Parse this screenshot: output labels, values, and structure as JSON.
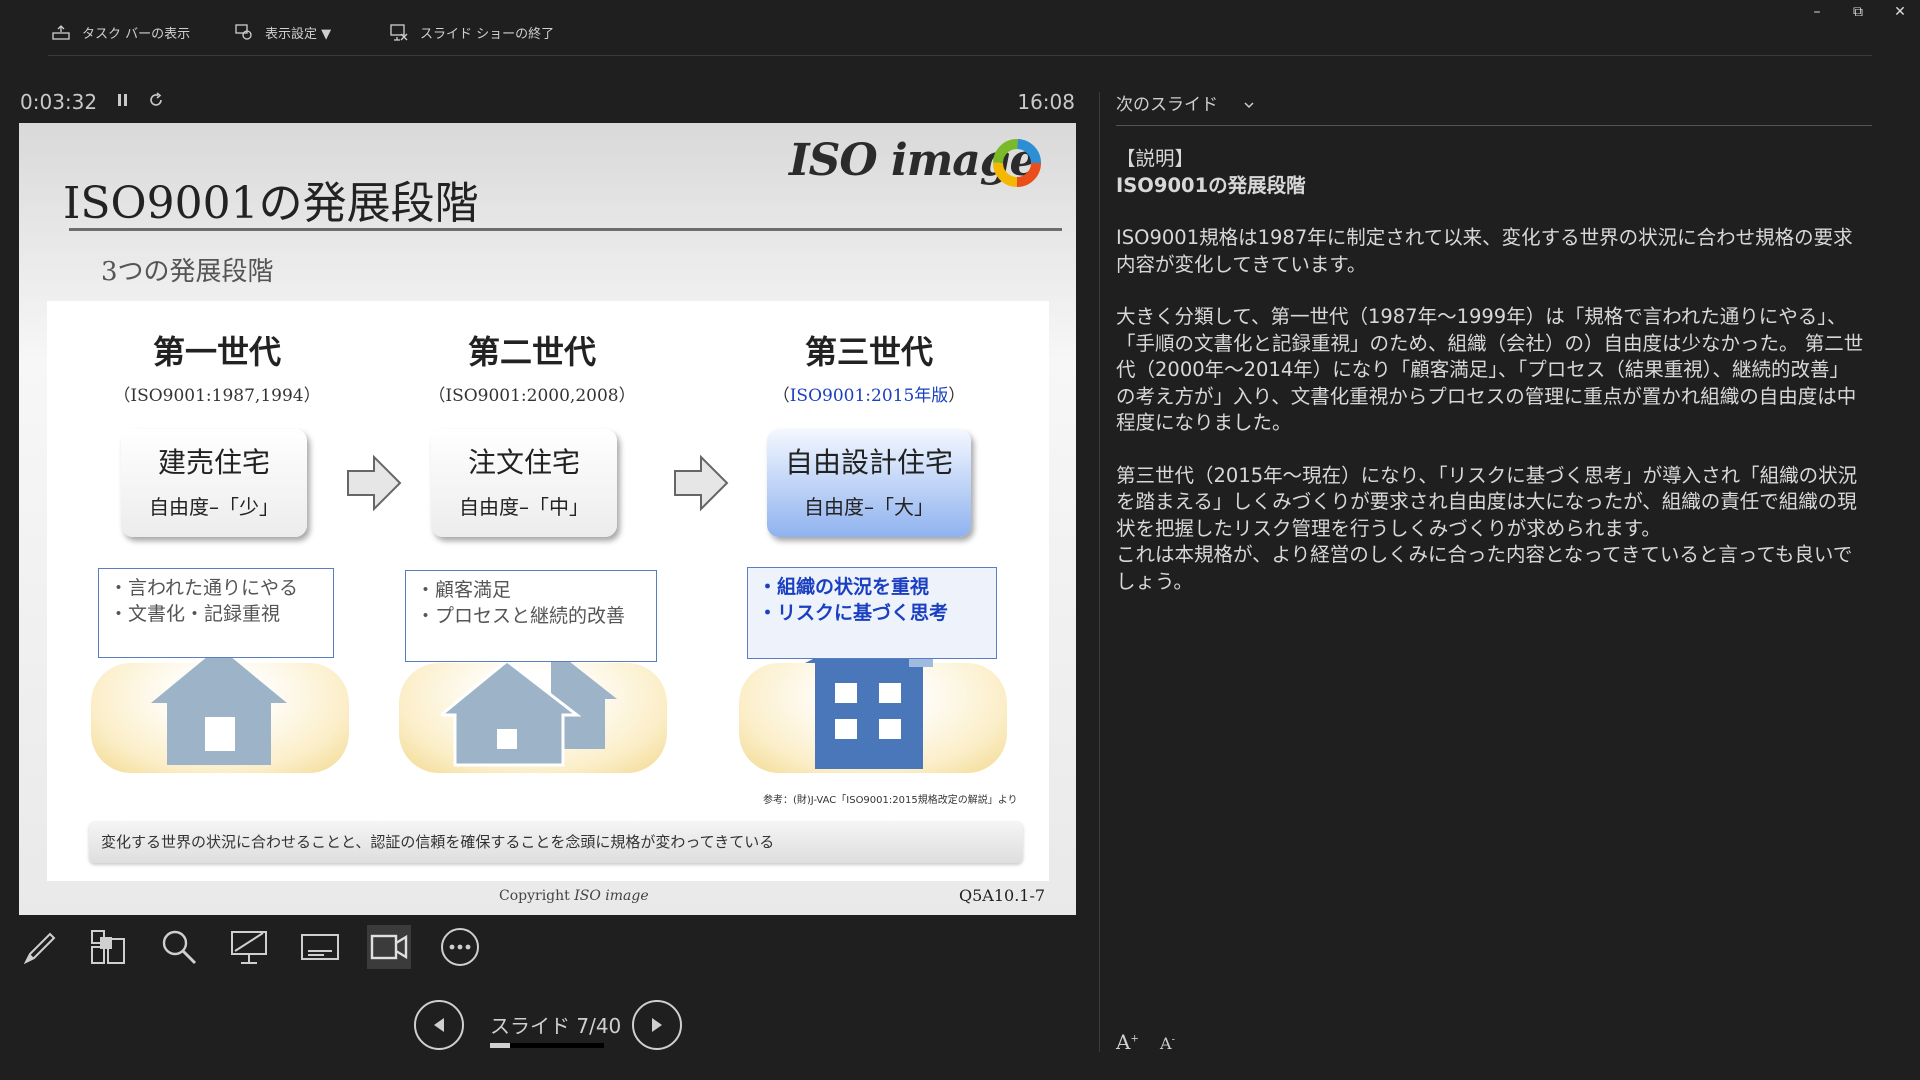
{
  "toolbar": {
    "taskbar_label": "タスク バーの表示",
    "display_settings_label": "表示設定 ▼",
    "end_show_label": "スライド ショーの終了"
  },
  "window": {
    "minimize": "–",
    "restore": "⧉",
    "close": "✕"
  },
  "presenter": {
    "timer": "0:03:32",
    "clock": "16:08",
    "slide_counter": "スライド 7/40",
    "progress": 0.175
  },
  "slide": {
    "title": "ISO9001の発展段階",
    "logo_text": "ISO image",
    "subtitle": "3つの発展段階",
    "generations": [
      {
        "name": "第一世代",
        "std": "（ISO9001:1987,1994）",
        "house": "建売住宅",
        "freedom": "自由度–「少」",
        "notes": [
          "・言われた通りにやる",
          "・文書化・記録重視"
        ]
      },
      {
        "name": "第二世代",
        "std": "（ISO9001:2000,2008）",
        "house": "注文住宅",
        "freedom": "自由度–「中」",
        "notes": [
          "・顧客満足",
          "・プロセスと継続的改善"
        ]
      },
      {
        "name": "第三世代",
        "std": "ISO9001:2015年版",
        "house": "自由設計住宅",
        "freedom": "自由度–「大」",
        "notes": [
          "・組織の状況を重視",
          "・リスクに基づく思考"
        ]
      }
    ],
    "paren_open": "（",
    "paren_close": "）",
    "reference": "参考：(財)J-VAC「ISO9001:2015規格改定の解説」より",
    "bottom_text": "変化する世界の状況に合わせることと、認証の信頼を確保することを念頭に規格が変わってきている",
    "copyright": "Copyright",
    "copyright_logo": "ISO image",
    "code": "Q5A10.1-7"
  },
  "right": {
    "next_slide_label": "次のスライド",
    "notes": [
      "【説明】",
      "ISO9001の発展段階",
      "ISO9001規格は1987年に制定されて以来、変化する世界の状況に合わせ規格の要求内容が変化してきています。",
      "大きく分類して、第一世代（1987年～1999年）は「規格で言われた通りにやる」、「手順の文書化と記録重視」のため、組織（会社）の）自由度は少なかった。 第二世代（2000年～2014年）になり「顧客満足」、「プロセス（結果重視）、継続的改善」の考え方が」入り、文書化重視からプロセスの管理に重点が置かれ組織の自由度は中程度になりました。",
      "第三世代（2015年～現在）になり、「リスクに基づく思考」が導入され「組織の状況を踏まえる」しくみづくりが要求され自由度は大になったが、組織の責任で組織の現状を把握したリスク管理を行うしくみづくりが求められます。",
      "これは本規格が、より経営のしくみに合った内容となってきていると言っても良いでしょう。"
    ],
    "font_larger": "A",
    "font_smaller": "A"
  }
}
